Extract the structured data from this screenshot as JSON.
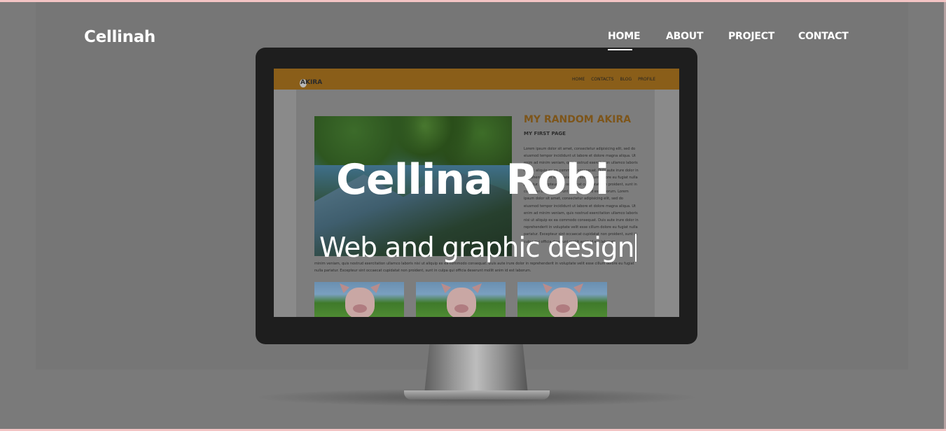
{
  "brand": "Cellinah",
  "nav": [
    {
      "label": "HOME",
      "active": true
    },
    {
      "label": "ABOUT",
      "active": false
    },
    {
      "label": "PROJECT",
      "active": false
    },
    {
      "label": "CONTACT",
      "active": false
    }
  ],
  "hero": {
    "name": "Cellina Robi",
    "tagline": "Web and graphic design"
  },
  "mockup": {
    "logo": "AKIRA",
    "nav": [
      "HOME",
      "CONTACTS",
      "BLOG",
      "PROFILE"
    ],
    "title": "MY RANDOM AKIRA",
    "subtitle": "MY FIRST PAGE",
    "paragraph": "Lorem ipsum dolor sit amet, consectetur adipisicing elit, sed do eiusmod tempor incididunt ut labore et dolore magna aliqua. Ut enim ad minim veniam, quis nostrud exercitation ullamco laboris nisi ut aliquip ex ea commodo consequat. Duis aute irure dolor in reprehenderit in voluptate velit esse cillum dolore eu fugiat nulla pariatur. Excepteur sint occaecat cupidatat non proident, sunt in culpa qui officia deserunt mollit anim id est laborum. Lorem ipsum dolor sit amet, consectetur adipisicing elit, sed do eiusmod tempor incididunt ut labore et dolore magna aliqua. Ut enim ad minim veniam, quis nostrud exercitation ullamco laboris nisi ut aliquip ex ea commodo consequat. Duis aute irure dolor in reprehenderit in voluptate velit esse cillum dolore eu fugiat nulla pariatur. Excepteur sint occaecat cupidatat non proident, sunt in culpa qui officia deserunt mollit anim id est laborum.",
    "paragraph2": "minim veniam, quis nostrud exercitation ullamco laboris nisi ut aliquip ex ea commodo consequat. Duis aute irure dolor in reprehenderit in voluptate velit esse cillum dolore eu fugiat nulla pariatur. Excepteur sint occaecat cupidatat non proident, sunt in culpa qui officia deserunt mollit anim id est laborum."
  },
  "colors": {
    "overlay": "#7a7a7a",
    "mockup_header": "#8a5e19",
    "mockup_title": "#7d551a",
    "accent_border": "#f3c4c4"
  }
}
